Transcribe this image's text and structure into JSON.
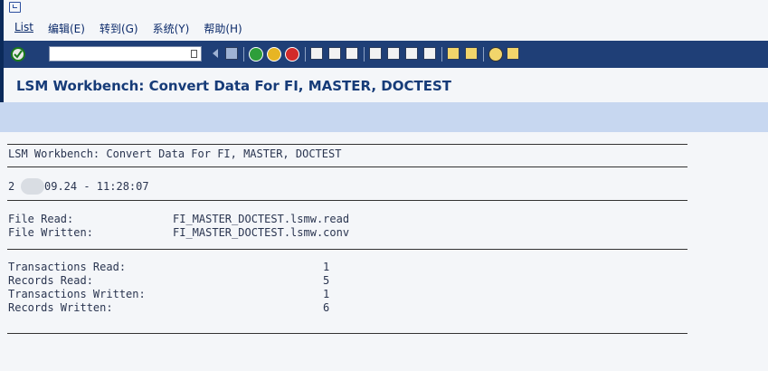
{
  "menubar": {
    "items": [
      {
        "label": "List"
      },
      {
        "label": "编辑(E)"
      },
      {
        "label": "转到(G)"
      },
      {
        "label": "系统(Y)"
      },
      {
        "label": "帮助(H)"
      }
    ]
  },
  "toolbar": {
    "command_field_value": "",
    "icons": [
      "enter-icon",
      "input-history-icon",
      "back-arrow-icon",
      "save-icon",
      "back-icon",
      "exit-icon",
      "cancel-icon",
      "print-icon",
      "find-icon",
      "find-next-icon",
      "first-page-icon",
      "previous-page-icon",
      "next-page-icon",
      "last-page-icon",
      "create-session-icon",
      "shortcut-icon",
      "help-icon",
      "layout-icon"
    ]
  },
  "page": {
    "title": "LSM Workbench: Convert Data For FI, MASTER, DOCTEST"
  },
  "report": {
    "header": "LSM Workbench: Convert Data For FI, MASTER, DOCTEST",
    "date_prefix": "2",
    "datetime": "09.24 - 11:28:07",
    "files": [
      {
        "label": "File Read:",
        "value": "FI_MASTER_DOCTEST.lsmw.read"
      },
      {
        "label": "File Written:",
        "value": "FI_MASTER_DOCTEST.lsmw.conv"
      }
    ],
    "stats": [
      {
        "label": "Transactions Read:",
        "value": "1"
      },
      {
        "label": "Records Read:",
        "value": "5"
      },
      {
        "label": "Transactions Written:",
        "value": "1"
      },
      {
        "label": "Records Written:",
        "value": "6"
      }
    ]
  }
}
